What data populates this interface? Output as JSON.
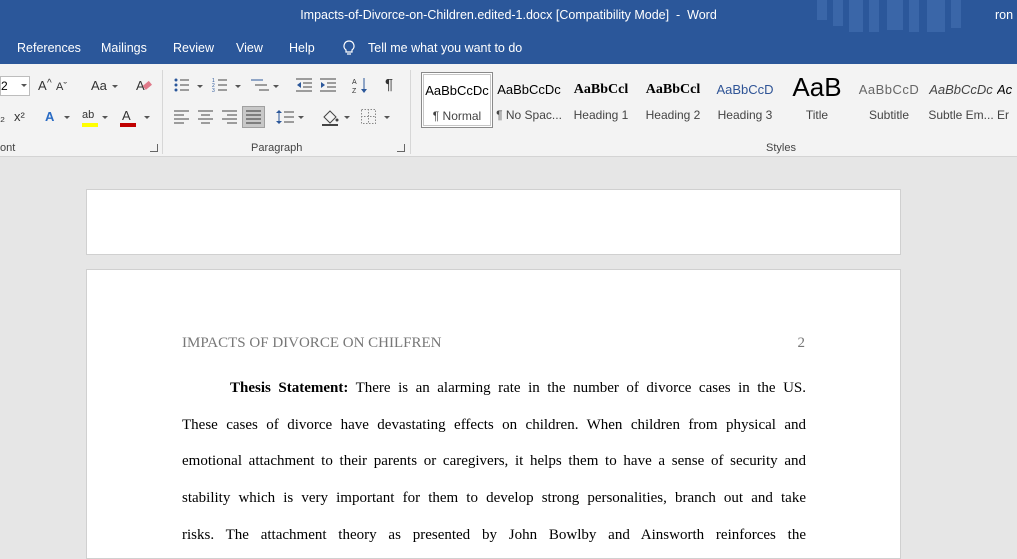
{
  "window": {
    "title": "Impacts-of-Divorce-on-Children.edited-1.docx [Compatibility Mode]  -  Word",
    "user": "ron"
  },
  "menu": {
    "items": [
      "References",
      "Mailings",
      "Review",
      "View",
      "Help"
    ],
    "tell_me": "Tell me what you want to do"
  },
  "ribbon": {
    "font_size": "2",
    "groups": {
      "font": "ont",
      "paragraph": "Paragraph",
      "styles": "Styles"
    },
    "icons": {
      "grow_font": "A",
      "case": "Aa",
      "superscript": "x²",
      "text_effects": "A",
      "highlight": "ab",
      "font_color": "A",
      "pilcrow": "¶"
    },
    "styles_gallery": [
      {
        "sample": "AaBbCcDc",
        "name": "¶ Normal",
        "selected": true
      },
      {
        "sample": "AaBbCcDc",
        "name": "¶ No Spac..."
      },
      {
        "sample": "AaBbCcl",
        "name": "Heading 1"
      },
      {
        "sample": "AaBbCcl",
        "name": "Heading 2"
      },
      {
        "sample": "AaBbCcD",
        "name": "Heading 3"
      },
      {
        "sample": "AaB",
        "name": "Title"
      },
      {
        "sample": "AaBbCcD",
        "name": "Subtitle"
      },
      {
        "sample": "AaBbCcDc",
        "name": "Subtle Em..."
      },
      {
        "sample": "Ac",
        "name": "Er"
      }
    ]
  },
  "colors": {
    "word_blue": "#2b579a",
    "font_color_red": "#c00000",
    "highlight_yellow": "#ffff00",
    "heading_blue": "#2f5496"
  },
  "document": {
    "running_head": "IMPACTS OF DIVORCE ON CHILFREN",
    "page_number": "2",
    "thesis_label": "Thesis Statement:",
    "lines": [
      "There is an alarming rate in the number of divorce cases in the US.",
      "These cases of divorce have devastating effects on children. When children from physical and",
      "emotional attachment to their parents or caregivers, it helps them to have a sense of security and",
      "stability which is very important for them to develop strong personalities, branch out and take",
      "risks. The attachment theory as presented by John Bowlby and Ainsworth reinforces the"
    ]
  }
}
